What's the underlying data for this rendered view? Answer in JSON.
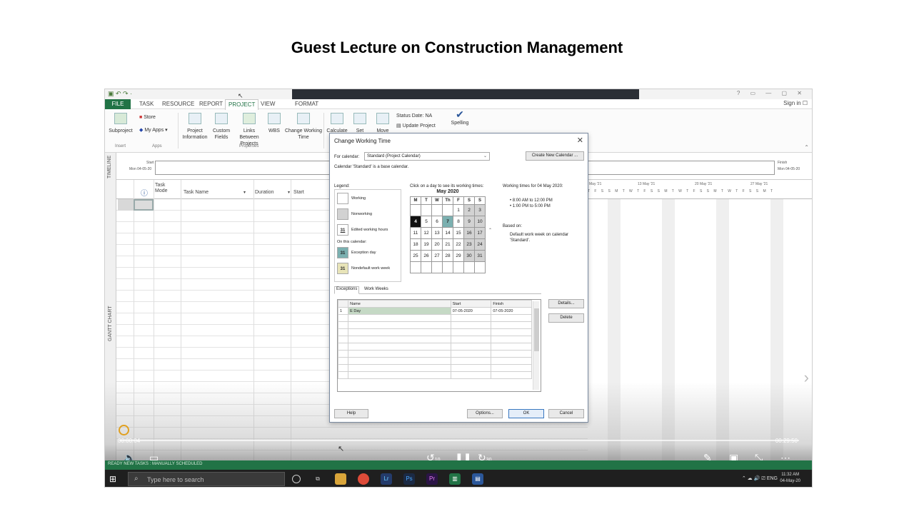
{
  "slide": {
    "title": "Guest Lecture on Construction Management"
  },
  "app": {
    "quick_access": "▣ ↶ ↷ ·",
    "window_controls": "? ▭ — ▢ ✕",
    "tabs": {
      "file": "FILE",
      "task": "TASK",
      "resource": "RESOURCE",
      "report": "REPORT",
      "project": "PROJECT",
      "view": "VIEW",
      "format": "FORMAT"
    },
    "signin": "Sign in",
    "ribbon": {
      "subproject": "Subproject",
      "store": "Store",
      "my_apps": "My Apps",
      "project_information": "Project Information",
      "custom_fields": "Custom Fields",
      "links_between_projects": "Links Between Projects",
      "wbs": "WBS",
      "change_working_time": "Change Working Time",
      "calculate": "Calculate",
      "set": "Set",
      "move": "Move",
      "status_date": "Status Date: NA",
      "update_project": "Update Project",
      "spelling": "Spelling",
      "group_insert": "Insert",
      "group_apps": "Apps",
      "group_properties": "Properties"
    },
    "timeline": {
      "label": "TIMELINE",
      "start_label": "Start",
      "start_date": "Mon 04-05-20",
      "finish_label": "Finish",
      "finish_date": "Mon 04-05-20"
    },
    "gantt": {
      "label": "GANTT CHART",
      "columns": {
        "info": "ⓘ",
        "task_mode": "Task Mode",
        "task_name": "Task Name",
        "duration": "Duration",
        "start": "Start"
      },
      "week_labels": [
        "May '21",
        "13 May '21",
        "20 May '21",
        "27 May '21"
      ],
      "day_letters": "T F S S M T W T F S S M T W T F S S M T W T F S S M T"
    },
    "status_bar": "READY   NEW TASKS : MANUALLY SCHEDULED"
  },
  "video": {
    "current_time": "00:00:04",
    "total_time": "00:29:50",
    "rewind_label": "10",
    "forward_label": "30"
  },
  "taskbar": {
    "search_placeholder": "Type here to search",
    "tray": "ENG",
    "time": "11:32 AM",
    "date": "04-May-20"
  },
  "dialog": {
    "title": "Change Working Time",
    "for_calendar_label": "For calendar:",
    "calendar_value": "Standard (Project Calendar)",
    "create_new_calendar": "Create New Calendar ...",
    "base_note": "Calendar 'Standard' is a base calendar.",
    "legend_label": "Legend:",
    "legend": {
      "working": "Working",
      "nonworking": "Nonworking",
      "edited": "Edited working hours",
      "on_this_calendar": "On this calendar:",
      "exception_day": "Exception day",
      "nondefault_week": "Nondefault work week",
      "day_glyph": "31"
    },
    "click_hint": "Click on a day to see its working times:",
    "month_title": "May 2020",
    "weekdays": [
      "M",
      "T",
      "W",
      "Th",
      "F",
      "S",
      "S"
    ],
    "weeks": [
      [
        "",
        "",
        "",
        "",
        "1",
        "2",
        "3"
      ],
      [
        "4",
        "5",
        "6",
        "7",
        "8",
        "9",
        "10"
      ],
      [
        "11",
        "12",
        "13",
        "14",
        "15",
        "16",
        "17"
      ],
      [
        "18",
        "19",
        "20",
        "21",
        "22",
        "23",
        "24"
      ],
      [
        "25",
        "26",
        "27",
        "28",
        "29",
        "30",
        "31"
      ],
      [
        "",
        "",
        "",
        "",
        "",
        "",
        ""
      ]
    ],
    "working_times_title": "Working times for 04 May 2020:",
    "working_times": [
      "• 8:00 AM to 12:00 PM",
      "• 1:00 PM to 5:00 PM"
    ],
    "based_on_label": "Based on:",
    "based_on_text": "Default work week on calendar 'Standard'.",
    "tabs": {
      "exceptions": "Exceptions",
      "work_weeks": "Work Weeks"
    },
    "table_headers": {
      "name": "Name",
      "start": "Start",
      "finish": "Finish"
    },
    "exceptions": [
      {
        "id": "1",
        "name": "E Day",
        "start": "07-05-2020",
        "finish": "07-05-2020"
      }
    ],
    "buttons": {
      "details": "Details...",
      "delete": "Delete",
      "help": "Help",
      "options": "Options...",
      "ok": "OK",
      "cancel": "Cancel"
    }
  }
}
